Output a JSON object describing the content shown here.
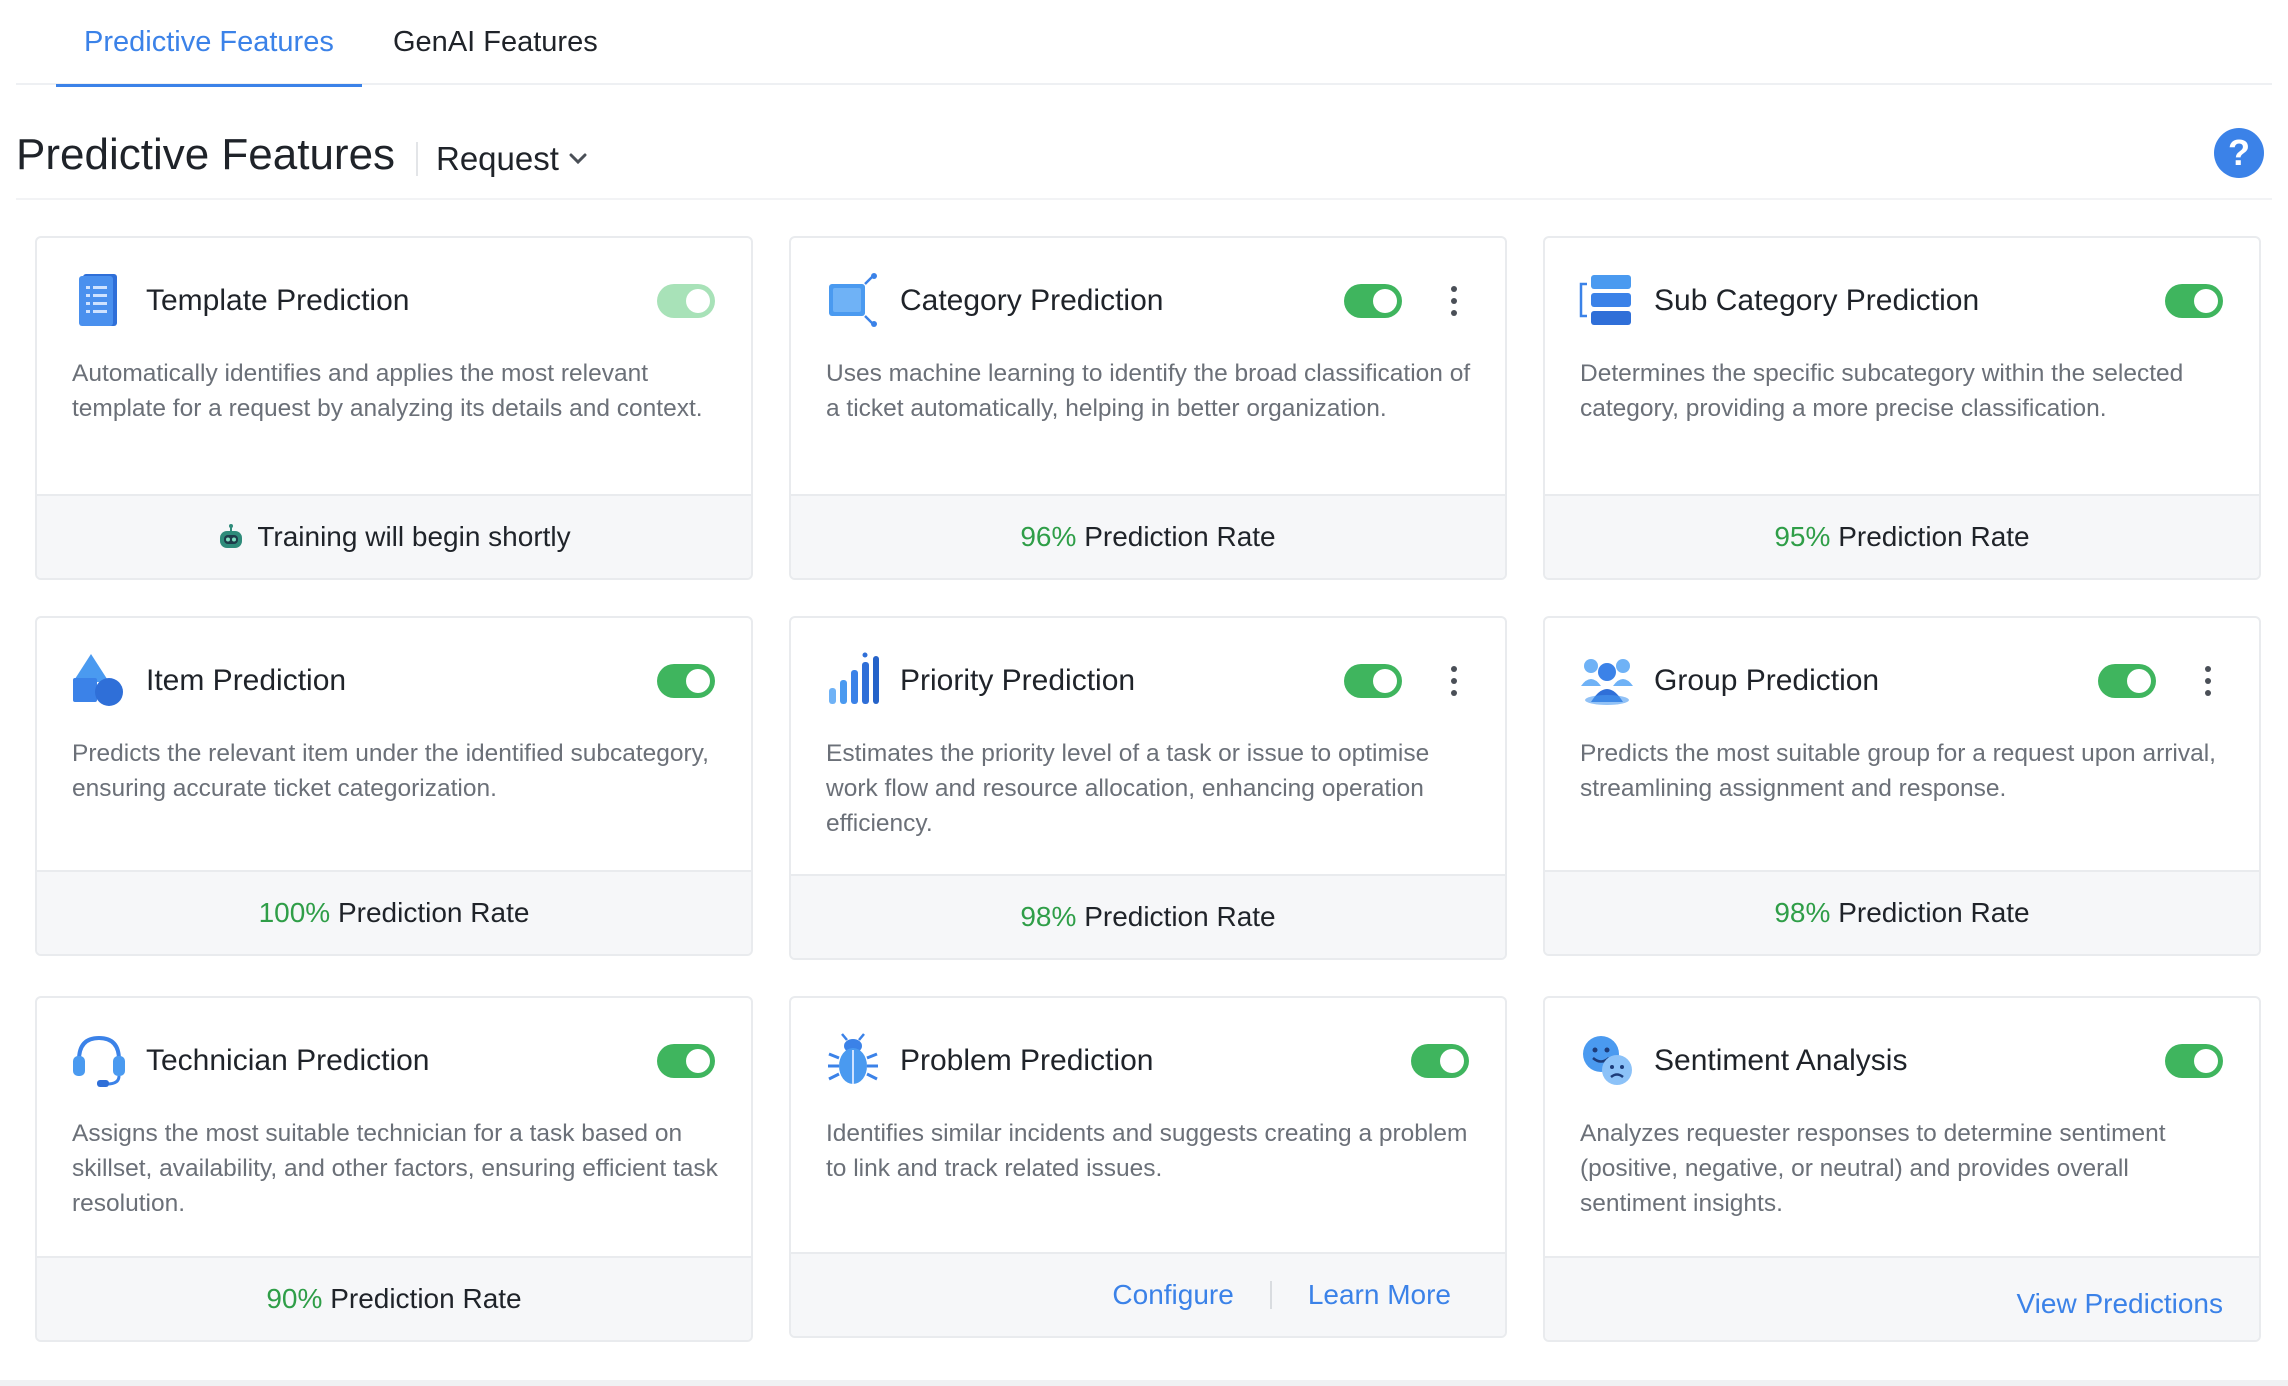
{
  "tabs": [
    {
      "label": "Predictive Features",
      "active": true
    },
    {
      "label": "GenAI Features",
      "active": false
    }
  ],
  "header": {
    "title": "Predictive Features",
    "module": "Request",
    "help": "?"
  },
  "colors": {
    "accent": "#3b82e8",
    "toggle_on": "#3fb55e",
    "rate_green": "#2f9e48"
  },
  "cards": [
    {
      "title": "Template Prediction",
      "icon": "template-icon",
      "enabled": true,
      "desc": "Automatically identifies and applies the most relevant template for a request by analyzing its details and context.",
      "footer_text": "Training will begin shortly"
    },
    {
      "title": "Category Prediction",
      "icon": "category-icon",
      "enabled": true,
      "desc": "Uses machine learning to identify the broad classification of a ticket automatically, helping in better organization.",
      "rate": "96%",
      "rate_label": "Prediction Rate"
    },
    {
      "title": "Sub Category Prediction",
      "icon": "subcategory-icon",
      "enabled": true,
      "desc": "Determines the specific subcategory within the selected category, providing a more precise classification.",
      "rate": "95%",
      "rate_label": "Prediction Rate"
    },
    {
      "title": "Item Prediction",
      "icon": "item-icon",
      "enabled": true,
      "desc": "Predicts the relevant item under the identified subcategory, ensuring accurate ticket categorization.",
      "rate": "100%",
      "rate_label": "Prediction Rate"
    },
    {
      "title": "Priority Prediction",
      "icon": "priority-bars-icon",
      "enabled": true,
      "desc": "Estimates the priority level of a task or issue to optimise work flow and resource allocation, enhancing operation efficiency.",
      "rate": "98%",
      "rate_label": "Prediction Rate"
    },
    {
      "title": "Group Prediction",
      "icon": "group-icon",
      "enabled": true,
      "desc": "Predicts the most suitable group for a request upon arrival, streamlining assignment and response.",
      "rate": "98%",
      "rate_label": "Prediction Rate"
    },
    {
      "title": "Technician Prediction",
      "icon": "headset-icon",
      "enabled": true,
      "desc": "Assigns the most suitable technician for a task based on skillset, availability, and other factors, ensuring efficient task resolution.",
      "rate": "90%",
      "rate_label": "Prediction Rate"
    },
    {
      "title": "Problem Prediction",
      "icon": "bug-icon",
      "enabled": true,
      "desc": "Identifies similar incidents and suggests creating a problem to link and track related issues.",
      "configure": "Configure",
      "learn_more": "Learn More"
    },
    {
      "title": "Sentiment Analysis",
      "icon": "sentiment-icon",
      "enabled": true,
      "desc": "Analyzes requester responses to determine sentiment (positive, negative, or neutral) and provides overall sentiment insights.",
      "view_predictions": "View Predictions"
    }
  ]
}
